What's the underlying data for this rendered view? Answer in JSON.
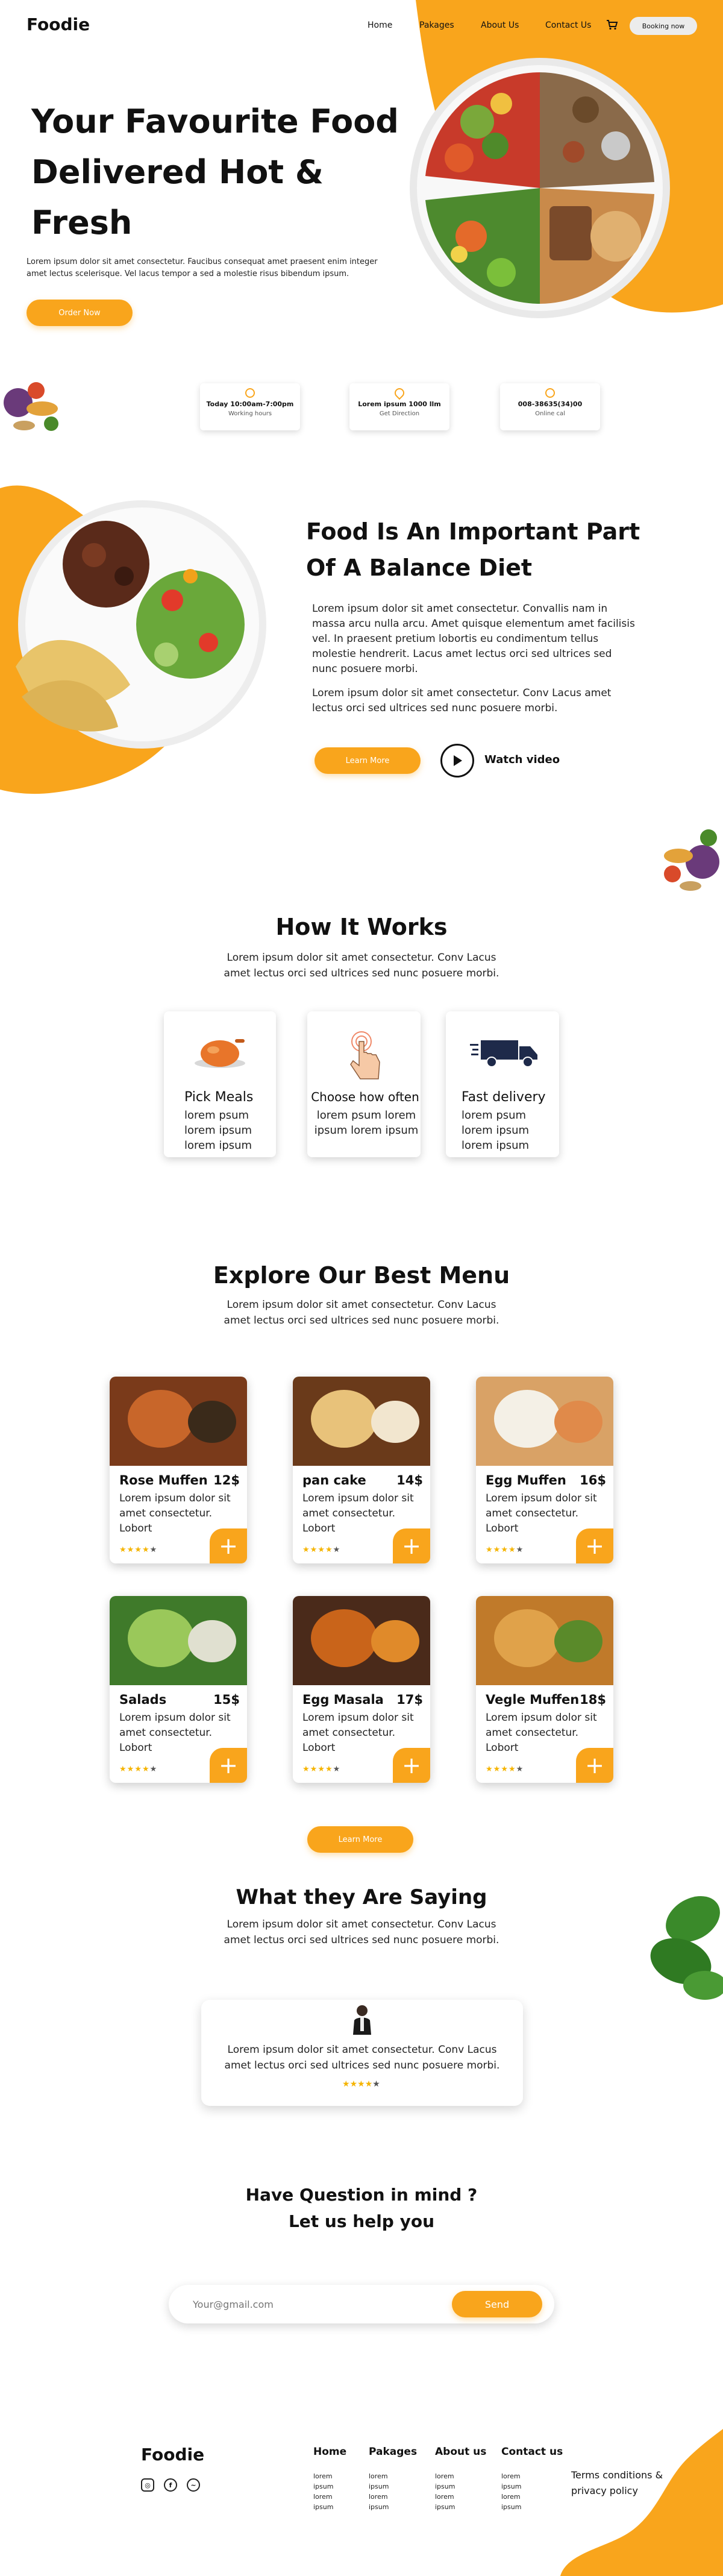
{
  "brand": "Foodie",
  "nav": {
    "items": [
      "Home",
      "Pakages",
      "About Us",
      "Contact Us"
    ],
    "booking": "Booking now"
  },
  "hero": {
    "title_lines": [
      "Your Favourite Food",
      "Delivered Hot &",
      "Fresh"
    ],
    "text": "Lorem ipsum dolor sit amet consectetur. Faucibus consequat amet praesent enim integer amet lectus scelerisque. Vel lacus tempor a sed a molestie risus bibendum ipsum.",
    "cta": "Order Now"
  },
  "info_cards": [
    {
      "icon": "clock-icon",
      "line1": "Today 10:00am-7:00pm",
      "line2": "Working hours"
    },
    {
      "icon": "location-pin-icon",
      "line1": "Lorem ipsum 1000 llm",
      "line2": "Get Direction"
    },
    {
      "icon": "phone-icon",
      "line1": "008-38635(34)00",
      "line2": "Online cal"
    }
  ],
  "balance": {
    "title_lines": [
      "Food Is An Important Part",
      "Of A Balance Diet"
    ],
    "p1": "Lorem ipsum dolor sit amet consectetur. Convallis nam in massa arcu nulla arcu. Amet quisque elementum amet facilisis vel. In praesent pretium lobortis eu condimentum tellus molestie hendrerit. Lacus amet lectus orci sed ultrices sed nunc posuere morbi.",
    "p2": "Lorem ipsum dolor sit amet consectetur. Conv Lacus amet lectus orci sed ultrices sed nunc posuere morbi.",
    "learn_more": "Learn More",
    "watch": "Watch video"
  },
  "how": {
    "title": "How It Works",
    "text": "Lorem ipsum dolor sit amet consectetur. Conv Lacus amet lectus orci sed ultrices sed nunc posuere morbi.",
    "cards": [
      {
        "icon": "roast-chicken-icon",
        "title": "Pick Meals",
        "l1": "lorem psum",
        "l2": "lorem ipsum",
        "l3": "lorem ipsum"
      },
      {
        "icon": "hand-tap-icon",
        "title": "Choose how often",
        "l1": "lorem psum lorem",
        "l2": "ipsum lorem ipsum",
        "l3": ""
      },
      {
        "icon": "delivery-truck-icon",
        "title": "Fast delivery",
        "l1": "lorem psum",
        "l2": "lorem ipsum",
        "l3": "lorem ipsum"
      }
    ]
  },
  "menu": {
    "title": "Explore Our Best Menu",
    "text": "Lorem ipsum dolor sit amet consectetur. Conv Lacus amet lectus orci sed ultrices sed nunc posuere morbi.",
    "items": [
      {
        "name": "Rose Muffen",
        "price": "12$",
        "desc": "Lorem ipsum dolor sit amet consectetur. Lobort",
        "rating": 4
      },
      {
        "name": "pan cake",
        "price": "14$",
        "desc": "Lorem ipsum dolor sit amet consectetur. Lobort",
        "rating": 4
      },
      {
        "name": "Egg Muffen",
        "price": "16$",
        "desc": "Lorem ipsum dolor sit amet consectetur. Lobort",
        "rating": 4
      },
      {
        "name": "Salads",
        "price": "15$",
        "desc": "Lorem ipsum dolor sit amet consectetur. Lobort",
        "rating": 4
      },
      {
        "name": "Egg Masala",
        "price": "17$",
        "desc": "Lorem ipsum dolor sit amet consectetur. Lobort",
        "rating": 4
      },
      {
        "name": "Vegle Muffen",
        "price": "18$",
        "desc": "Lorem ipsum dolor sit amet consectetur. Lobort",
        "rating": 4
      }
    ],
    "learn_more": "Learn More",
    "star_glyphs": "★★★★★"
  },
  "testimonials": {
    "title": "What they Are Saying",
    "text": "Lorem ipsum dolor sit amet consectetur. Conv Lacus amet lectus orci sed ultrices sed nunc posuere morbi.",
    "quote": "Lorem ipsum dolor sit amet consectetur. Conv Lacus amet lectus orci sed ultrices sed nunc posuere morbi.",
    "rating": 4
  },
  "contact": {
    "title_l1": "Have Question in mind ?",
    "title_l2": "Let us help you",
    "placeholder": "Your@gmail.com",
    "send": "Send"
  },
  "footer": {
    "brand": "Foodie",
    "columns": [
      {
        "title": "Home",
        "items": [
          "lorem",
          "ipsum",
          "lorem",
          "ipsum"
        ]
      },
      {
        "title": "Pakages",
        "items": [
          "lorem",
          "ipsum",
          "lorem",
          "ipsum"
        ]
      },
      {
        "title": "About us",
        "items": [
          "lorem",
          "ipsum",
          "lorem",
          "ipsum"
        ]
      },
      {
        "title": "Contact us",
        "items": [
          "lorem",
          "ipsum",
          "lorem",
          "ipsum"
        ]
      }
    ],
    "terms_l1": "Terms conditions &",
    "terms_l2": "privacy policy"
  },
  "colors": {
    "accent": "#F9A51C"
  }
}
